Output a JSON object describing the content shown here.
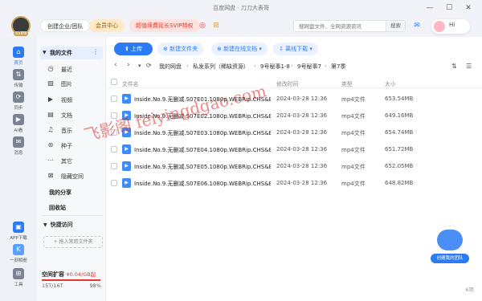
{
  "window": {
    "title": "百度网盘 · 刀刀大表哥"
  },
  "topbar": {
    "avatar_badge": "SVIP8",
    "enterprise": "创建企业/团队",
    "vip_center": "会员中心",
    "promo": "超值续费延长SVIP特权",
    "search_placeholder": "搜网盘文件、全网资源资讯",
    "search_button": "搜索",
    "hi": "Hi"
  },
  "rail": {
    "items": [
      {
        "icon": "home-icon",
        "label": "首页"
      },
      {
        "icon": "transfer-icon",
        "label": "传输"
      },
      {
        "icon": "share-icon",
        "label": "同步"
      },
      {
        "icon": "ai-icon",
        "label": "AI看"
      },
      {
        "icon": "message-icon",
        "label": "消息"
      }
    ],
    "bottom": [
      {
        "icon": "app-download-icon",
        "label": "APP下载"
      },
      {
        "icon": "ke-icon",
        "label": "一刻相册"
      },
      {
        "icon": "tools-icon",
        "label": "工具"
      }
    ]
  },
  "sidebar": {
    "my_files": "我的文件",
    "items": [
      {
        "icon": "recent-icon",
        "label": "最近"
      },
      {
        "icon": "image-icon",
        "label": "图片"
      },
      {
        "icon": "video-icon",
        "label": "视频"
      },
      {
        "icon": "document-icon",
        "label": "文档"
      },
      {
        "icon": "music-icon",
        "label": "音乐"
      },
      {
        "icon": "seed-icon",
        "label": "种子"
      },
      {
        "icon": "other-icon",
        "label": "其它"
      },
      {
        "icon": "lock-icon",
        "label": "隐藏空间"
      }
    ],
    "my_share": "我的分享",
    "recycle": "回收站",
    "quick_access": "快捷访问",
    "add_quick": "+ 拖入常用文件夹",
    "quota_title": "空间扩容",
    "quota_price": "¥0.04/GB起",
    "quota_usage": "15T/16T",
    "quota_percent": "98%",
    "quota_fraction": 0.98
  },
  "toolbar": {
    "upload": "上传",
    "new_folder": "新建文件夹",
    "new_online_doc": "新建在线文档",
    "offline_download": "离线下载"
  },
  "breadcrumb": [
    "我的网盘",
    "私发系列（稀缺资源）",
    "9号秘事1-8",
    "9号秘事7",
    "第7季"
  ],
  "table": {
    "headers": {
      "name": "文件名",
      "time": "修改时间",
      "type": "类型",
      "size": "大小"
    },
    "rows": [
      {
        "name": "Inside.No.9.无删减.S07E01.1080p.WEBRip.CHS&ENG...",
        "time": "2024-03-28 12:36",
        "type": "mp4文件",
        "size": "653.54MB"
      },
      {
        "name": "Inside.No.9.无删减.S07E02.1080p.WEBRip.CHS&ENG...",
        "time": "2024-03-28 12:36",
        "type": "mp4文件",
        "size": "649.16MB"
      },
      {
        "name": "Inside.No.9.无删减.S07E03.1080p.WEBRip.CHS&ENG...",
        "time": "2024-03-28 12:36",
        "type": "mp4文件",
        "size": "654.74MB"
      },
      {
        "name": "Inside.No.9.无删减.S07E04.1080p.WEBRip.CHS&ENG...",
        "time": "2024-03-28 12:36",
        "type": "mp4文件",
        "size": "651.72MB"
      },
      {
        "name": "Inside.No.9.无删减.S07E05.1080p.WEBRip.CHS&ENG...",
        "time": "2024-03-28 12:36",
        "type": "mp4文件",
        "size": "652.05MB"
      },
      {
        "name": "Inside.No.9.无删减.S07E06.1080p.WEBRip.CHS&ENG...",
        "time": "2024-03-28 12:36",
        "type": "mp4文件",
        "size": "648.82MB"
      }
    ],
    "count": "6项"
  },
  "watermark": "飞影阁 feiyingdgao.com",
  "team_badge": "创建我的团队",
  "colors": {
    "accent": "#2b7bf4",
    "promo_red": "#e2372c",
    "vip_gold": "#c8a25b"
  }
}
